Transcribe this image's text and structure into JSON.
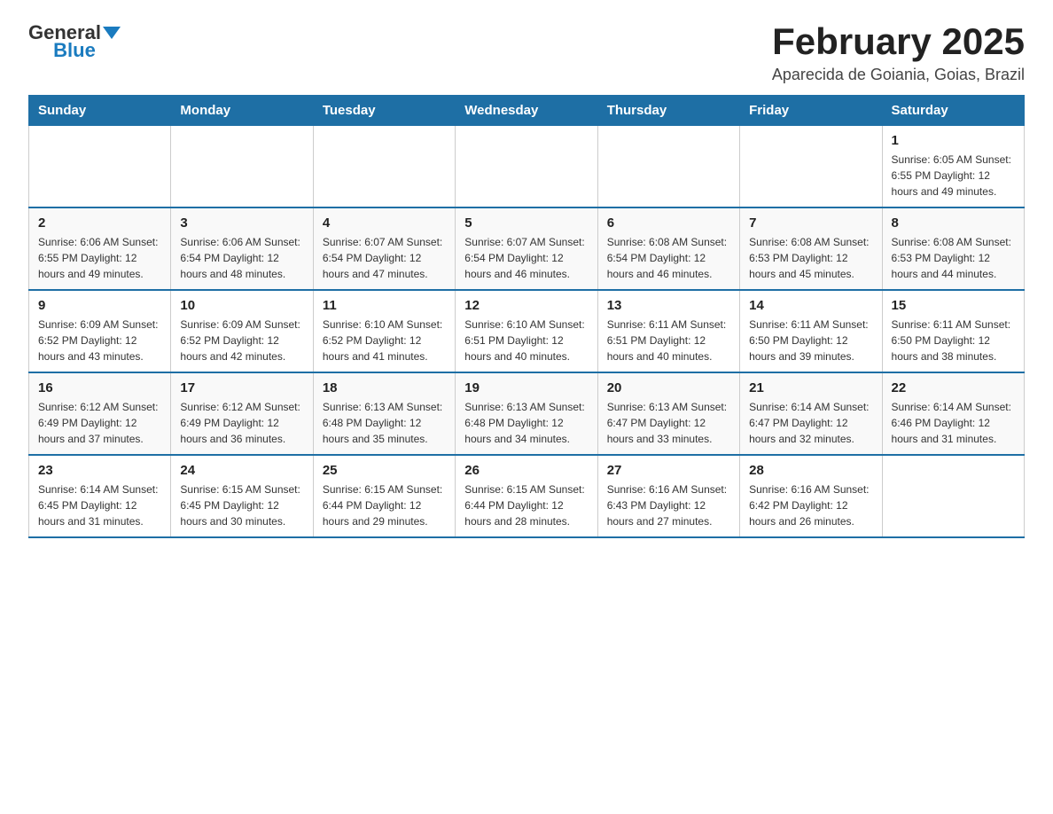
{
  "header": {
    "logo_general": "General",
    "logo_blue": "Blue",
    "month_title": "February 2025",
    "location": "Aparecida de Goiania, Goias, Brazil"
  },
  "weekdays": [
    "Sunday",
    "Monday",
    "Tuesday",
    "Wednesday",
    "Thursday",
    "Friday",
    "Saturday"
  ],
  "rows": [
    [
      {
        "day": "",
        "info": ""
      },
      {
        "day": "",
        "info": ""
      },
      {
        "day": "",
        "info": ""
      },
      {
        "day": "",
        "info": ""
      },
      {
        "day": "",
        "info": ""
      },
      {
        "day": "",
        "info": ""
      },
      {
        "day": "1",
        "info": "Sunrise: 6:05 AM\nSunset: 6:55 PM\nDaylight: 12 hours and 49 minutes."
      }
    ],
    [
      {
        "day": "2",
        "info": "Sunrise: 6:06 AM\nSunset: 6:55 PM\nDaylight: 12 hours and 49 minutes."
      },
      {
        "day": "3",
        "info": "Sunrise: 6:06 AM\nSunset: 6:54 PM\nDaylight: 12 hours and 48 minutes."
      },
      {
        "day": "4",
        "info": "Sunrise: 6:07 AM\nSunset: 6:54 PM\nDaylight: 12 hours and 47 minutes."
      },
      {
        "day": "5",
        "info": "Sunrise: 6:07 AM\nSunset: 6:54 PM\nDaylight: 12 hours and 46 minutes."
      },
      {
        "day": "6",
        "info": "Sunrise: 6:08 AM\nSunset: 6:54 PM\nDaylight: 12 hours and 46 minutes."
      },
      {
        "day": "7",
        "info": "Sunrise: 6:08 AM\nSunset: 6:53 PM\nDaylight: 12 hours and 45 minutes."
      },
      {
        "day": "8",
        "info": "Sunrise: 6:08 AM\nSunset: 6:53 PM\nDaylight: 12 hours and 44 minutes."
      }
    ],
    [
      {
        "day": "9",
        "info": "Sunrise: 6:09 AM\nSunset: 6:52 PM\nDaylight: 12 hours and 43 minutes."
      },
      {
        "day": "10",
        "info": "Sunrise: 6:09 AM\nSunset: 6:52 PM\nDaylight: 12 hours and 42 minutes."
      },
      {
        "day": "11",
        "info": "Sunrise: 6:10 AM\nSunset: 6:52 PM\nDaylight: 12 hours and 41 minutes."
      },
      {
        "day": "12",
        "info": "Sunrise: 6:10 AM\nSunset: 6:51 PM\nDaylight: 12 hours and 40 minutes."
      },
      {
        "day": "13",
        "info": "Sunrise: 6:11 AM\nSunset: 6:51 PM\nDaylight: 12 hours and 40 minutes."
      },
      {
        "day": "14",
        "info": "Sunrise: 6:11 AM\nSunset: 6:50 PM\nDaylight: 12 hours and 39 minutes."
      },
      {
        "day": "15",
        "info": "Sunrise: 6:11 AM\nSunset: 6:50 PM\nDaylight: 12 hours and 38 minutes."
      }
    ],
    [
      {
        "day": "16",
        "info": "Sunrise: 6:12 AM\nSunset: 6:49 PM\nDaylight: 12 hours and 37 minutes."
      },
      {
        "day": "17",
        "info": "Sunrise: 6:12 AM\nSunset: 6:49 PM\nDaylight: 12 hours and 36 minutes."
      },
      {
        "day": "18",
        "info": "Sunrise: 6:13 AM\nSunset: 6:48 PM\nDaylight: 12 hours and 35 minutes."
      },
      {
        "day": "19",
        "info": "Sunrise: 6:13 AM\nSunset: 6:48 PM\nDaylight: 12 hours and 34 minutes."
      },
      {
        "day": "20",
        "info": "Sunrise: 6:13 AM\nSunset: 6:47 PM\nDaylight: 12 hours and 33 minutes."
      },
      {
        "day": "21",
        "info": "Sunrise: 6:14 AM\nSunset: 6:47 PM\nDaylight: 12 hours and 32 minutes."
      },
      {
        "day": "22",
        "info": "Sunrise: 6:14 AM\nSunset: 6:46 PM\nDaylight: 12 hours and 31 minutes."
      }
    ],
    [
      {
        "day": "23",
        "info": "Sunrise: 6:14 AM\nSunset: 6:45 PM\nDaylight: 12 hours and 31 minutes."
      },
      {
        "day": "24",
        "info": "Sunrise: 6:15 AM\nSunset: 6:45 PM\nDaylight: 12 hours and 30 minutes."
      },
      {
        "day": "25",
        "info": "Sunrise: 6:15 AM\nSunset: 6:44 PM\nDaylight: 12 hours and 29 minutes."
      },
      {
        "day": "26",
        "info": "Sunrise: 6:15 AM\nSunset: 6:44 PM\nDaylight: 12 hours and 28 minutes."
      },
      {
        "day": "27",
        "info": "Sunrise: 6:16 AM\nSunset: 6:43 PM\nDaylight: 12 hours and 27 minutes."
      },
      {
        "day": "28",
        "info": "Sunrise: 6:16 AM\nSunset: 6:42 PM\nDaylight: 12 hours and 26 minutes."
      },
      {
        "day": "",
        "info": ""
      }
    ]
  ]
}
